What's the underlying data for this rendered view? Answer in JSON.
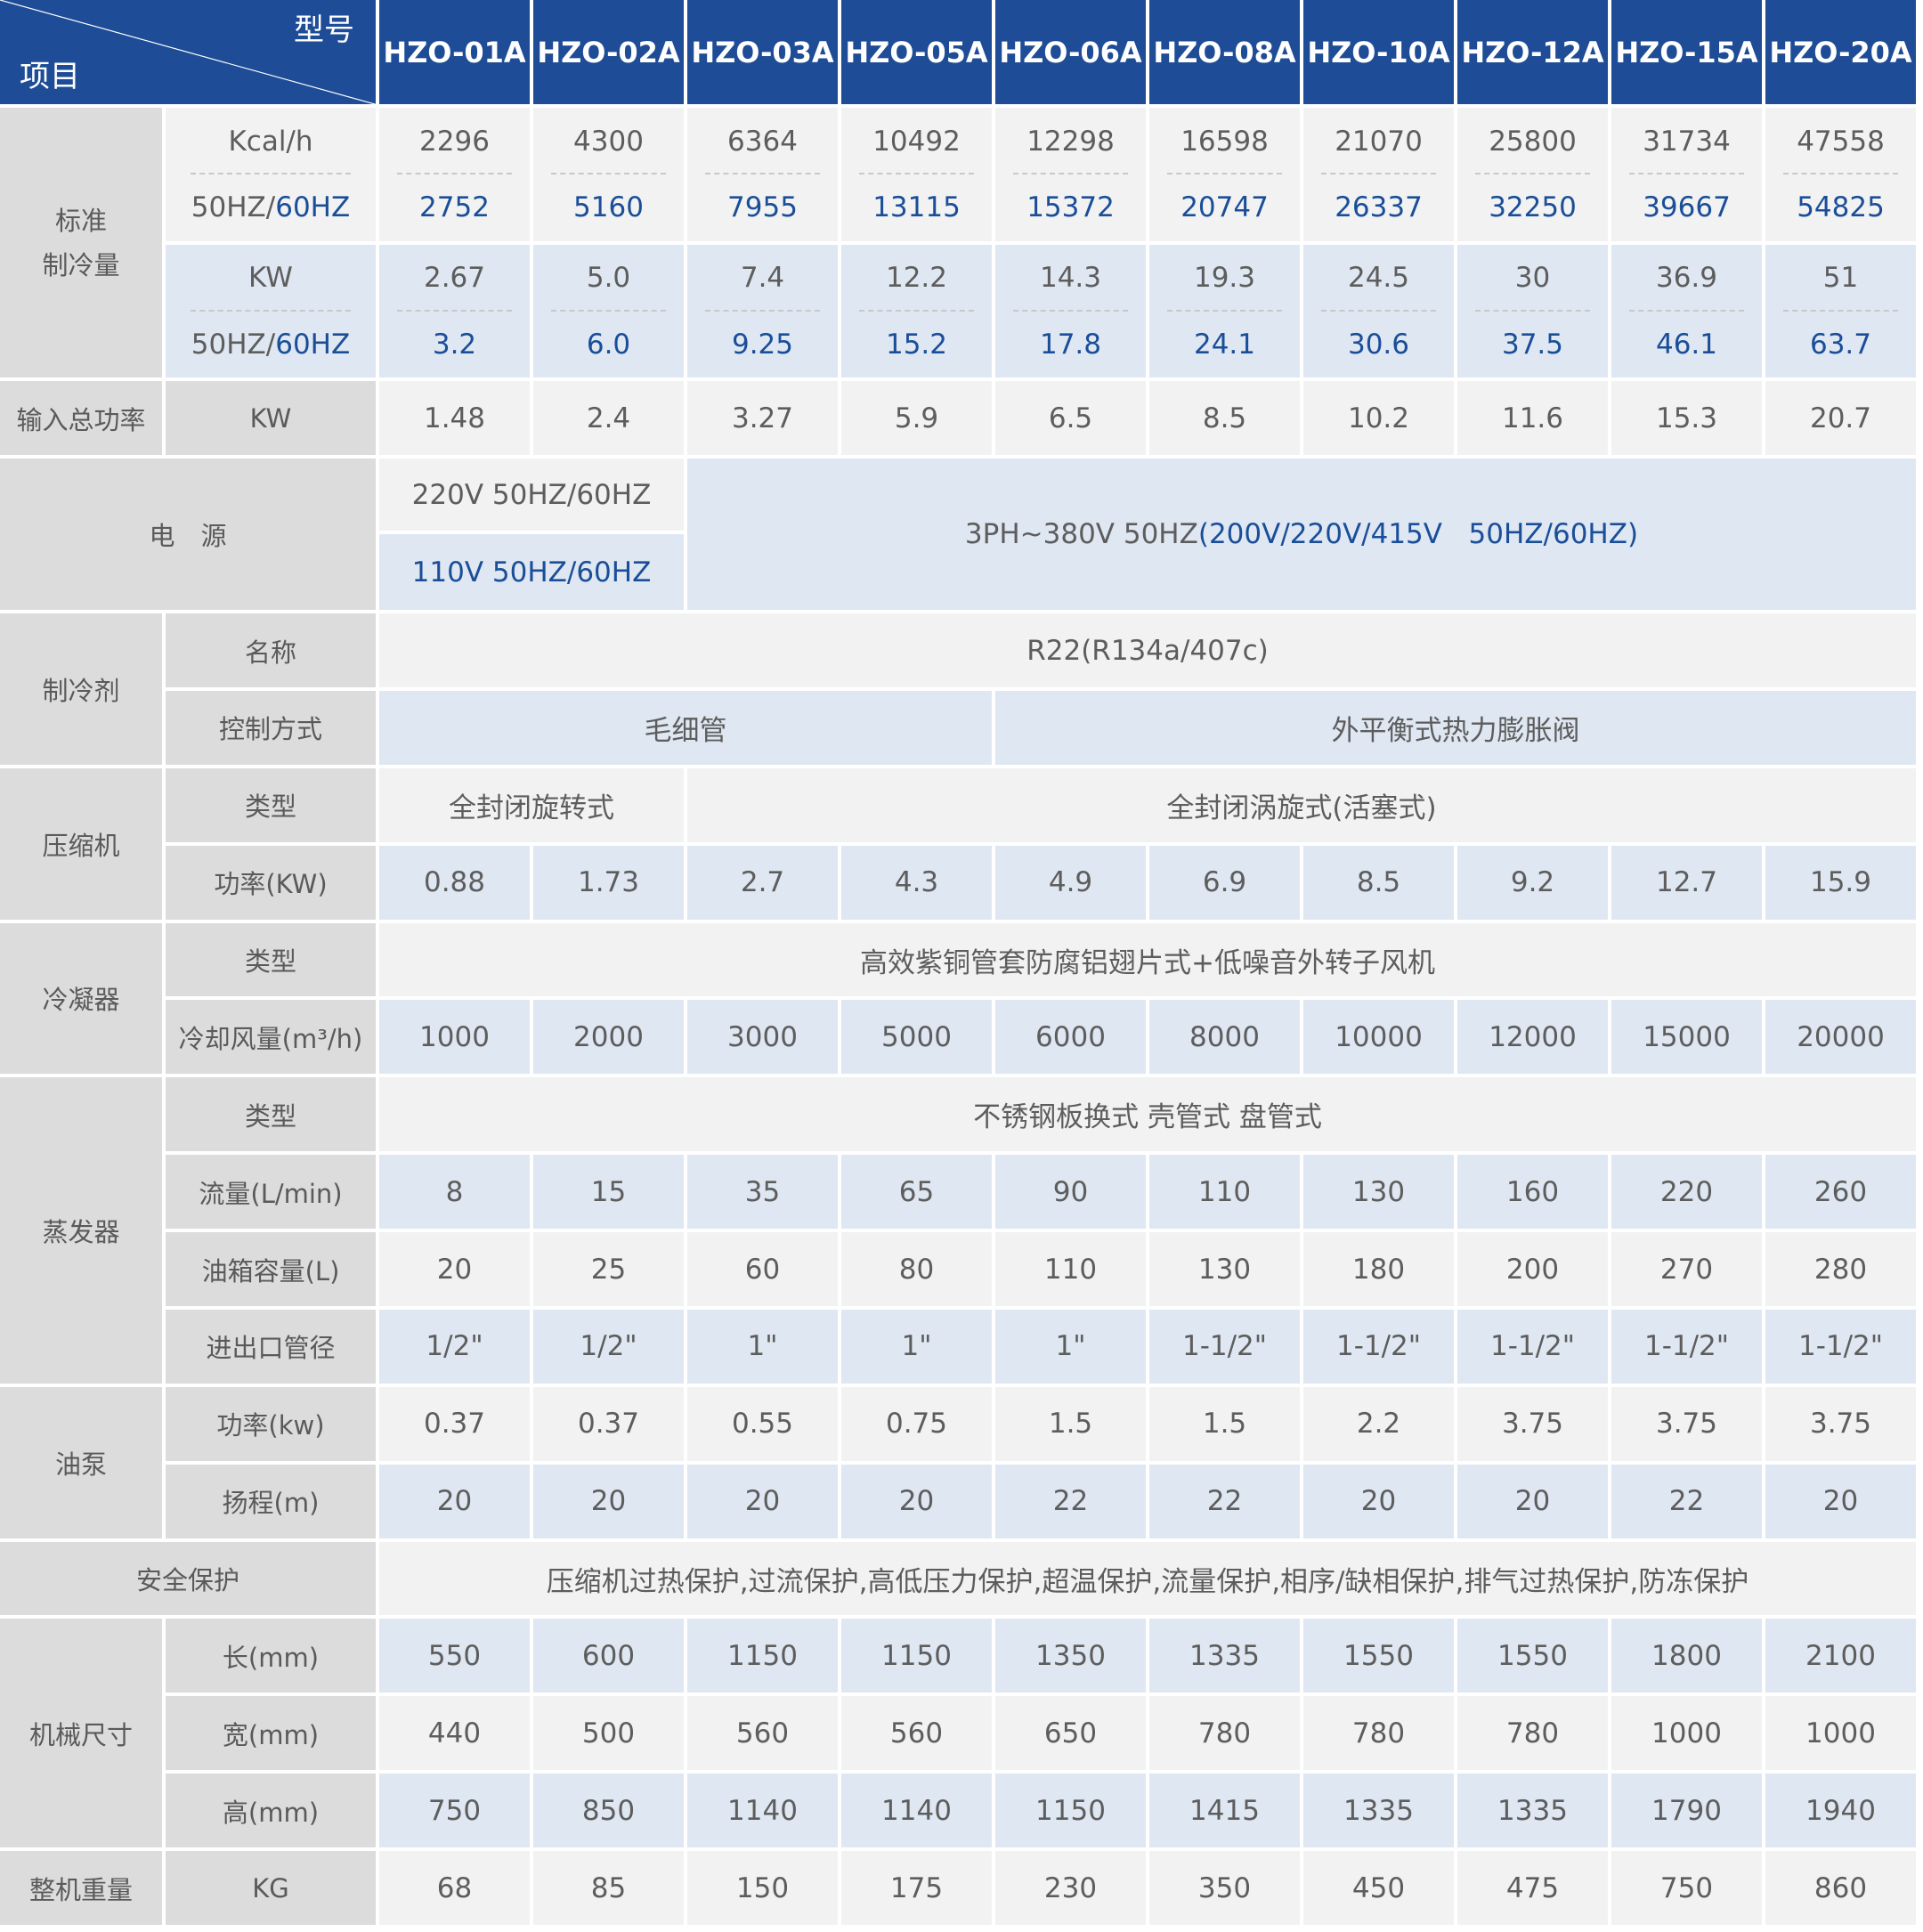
{
  "header": {
    "corner_top": "型号",
    "corner_bottom": "项目",
    "models": [
      "HZO-01A",
      "HZO-02A",
      "HZO-03A",
      "HZO-05A",
      "HZO-06A",
      "HZO-08A",
      "HZO-10A",
      "HZO-12A",
      "HZO-15A",
      "HZO-20A"
    ]
  },
  "cooling": {
    "category": "标准\n制冷量",
    "kcal_unit": "Kcal/h",
    "hz_label_a": "50HZ/",
    "hz_label_b": "60HZ",
    "kcal_50": [
      "2296",
      "4300",
      "6364",
      "10492",
      "12298",
      "16598",
      "21070",
      "25800",
      "31734",
      "47558"
    ],
    "kcal_60": [
      "2752",
      "5160",
      "7955",
      "13115",
      "15372",
      "20747",
      "26337",
      "32250",
      "39667",
      "54825"
    ],
    "kw_unit": "KW",
    "kw_50": [
      "2.67",
      "5.0",
      "7.4",
      "12.2",
      "14.3",
      "19.3",
      "24.5",
      "30",
      "36.9",
      "51"
    ],
    "kw_60": [
      "3.2",
      "6.0",
      "9.25",
      "15.2",
      "17.8",
      "24.1",
      "30.6",
      "37.5",
      "46.1",
      "63.7"
    ]
  },
  "input_power": {
    "category": "输入总功率",
    "unit": "KW",
    "values": [
      "1.48",
      "2.4",
      "3.27",
      "5.9",
      "6.5",
      "8.5",
      "10.2",
      "11.6",
      "15.3",
      "20.7"
    ]
  },
  "power_supply": {
    "category": "电　源",
    "small_a": "220V 50HZ/60HZ",
    "small_b": "110V 50HZ/60HZ",
    "large_a": "3PH~380V 50HZ",
    "large_b": "(200V/220V/415V   50HZ/60HZ)"
  },
  "refrigerant": {
    "category": "制冷剂",
    "name_label": "名称",
    "name_value": "R22(R134a/407c)",
    "control_label": "控制方式",
    "control_a": "毛细管",
    "control_b": "外平衡式热力膨胀阀"
  },
  "compressor": {
    "category": "压缩机",
    "type_label": "类型",
    "type_a": "全封闭旋转式",
    "type_b": "全封闭涡旋式(活塞式)",
    "power_label": "功率(KW)",
    "power": [
      "0.88",
      "1.73",
      "2.7",
      "4.3",
      "4.9",
      "6.9",
      "8.5",
      "9.2",
      "12.7",
      "15.9"
    ]
  },
  "condenser": {
    "category": "冷凝器",
    "type_label": "类型",
    "type_value": "高效紫铜管套防腐铝翅片式+低噪音外转子风机",
    "air_label": "冷却风量(m³/h)",
    "air": [
      "1000",
      "2000",
      "3000",
      "5000",
      "6000",
      "8000",
      "10000",
      "12000",
      "15000",
      "20000"
    ]
  },
  "evaporator": {
    "category": "蒸发器",
    "type_label": "类型",
    "type_value": "不锈钢板换式 壳管式 盘管式",
    "flow_label": "流量(L/min)",
    "flow": [
      "8",
      "15",
      "35",
      "65",
      "90",
      "110",
      "130",
      "160",
      "220",
      "260"
    ],
    "tank_label": "油箱容量(L)",
    "tank": [
      "20",
      "25",
      "60",
      "80",
      "110",
      "130",
      "180",
      "200",
      "270",
      "280"
    ],
    "pipe_label": "进出口管径",
    "pipe": [
      "1/2\"",
      "1/2\"",
      "1\"",
      "1\"",
      "1\"",
      "1-1/2\"",
      "1-1/2\"",
      "1-1/2\"",
      "1-1/2\"",
      "1-1/2\""
    ]
  },
  "pump": {
    "category": "油泵",
    "power_label": "功率(kw)",
    "power": [
      "0.37",
      "0.37",
      "0.55",
      "0.75",
      "1.5",
      "1.5",
      "2.2",
      "3.75",
      "3.75",
      "3.75"
    ],
    "head_label": "扬程(m)",
    "head": [
      "20",
      "20",
      "20",
      "20",
      "22",
      "22",
      "20",
      "20",
      "22",
      "20"
    ]
  },
  "safety": {
    "category": "安全保护",
    "value": "压缩机过热保护,过流保护,高低压力保护,超温保护,流量保护,相序/缺相保护,排气过热保护,防冻保护"
  },
  "dimensions": {
    "category": "机械尺寸",
    "length_label": "长(mm)",
    "length": [
      "550",
      "600",
      "1150",
      "1150",
      "1350",
      "1335",
      "1550",
      "1550",
      "1800",
      "2100"
    ],
    "width_label": "宽(mm)",
    "width": [
      "440",
      "500",
      "560",
      "560",
      "650",
      "780",
      "780",
      "780",
      "1000",
      "1000"
    ],
    "height_label": "高(mm)",
    "height": [
      "750",
      "850",
      "1140",
      "1140",
      "1150",
      "1415",
      "1335",
      "1335",
      "1790",
      "1940"
    ]
  },
  "weight": {
    "category": "整机重量",
    "unit": "KG",
    "values": [
      "68",
      "85",
      "150",
      "175",
      "230",
      "350",
      "450",
      "475",
      "750",
      "860"
    ]
  }
}
